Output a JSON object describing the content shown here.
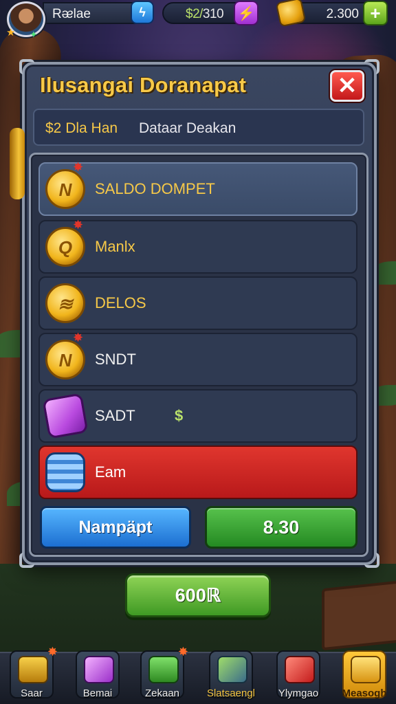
{
  "hud": {
    "player_name": "Rᴂlae",
    "cash_prefix": "$2/",
    "cash_value": "310",
    "coins": "2.300",
    "plus": "+"
  },
  "dialog": {
    "title": "Ilusangai Doranapat",
    "close": "✕",
    "subtitle_accent": "$2 Dla Han",
    "subtitle_rest": "Dataar Deakan",
    "rows": [
      {
        "label": "SALDO DOMPET",
        "icon_text": "N",
        "label_color": "#f7c948"
      },
      {
        "label": "Manlx",
        "icon_text": "Q",
        "label_color": "#f7c948"
      },
      {
        "label": "DELOS",
        "icon_text": "≋",
        "label_color": "#f7c948"
      },
      {
        "label": "SNDT",
        "icon_text": "N",
        "label_color": "#f0f0f0"
      },
      {
        "label": "SADT",
        "amount": "$",
        "label_color": "#f0f0f0"
      },
      {
        "label": "Eam",
        "label_color": "#ffffff"
      }
    ],
    "btn_left": "Nampäpt",
    "btn_right": "8.30"
  },
  "bottom_button": "600ℝ",
  "nav": [
    {
      "label": "Saar",
      "icon": "treasure-chest-icon"
    },
    {
      "label": "Bemai",
      "icon": "gift-box-icon"
    },
    {
      "label": "Zekaan",
      "icon": "cash-stack-icon"
    },
    {
      "label": "Slatsaengl",
      "icon": "sword-icon"
    },
    {
      "label": "Ylymgao",
      "icon": "red-gift-icon"
    },
    {
      "label": "Measogh",
      "icon": "gold-chest-icon"
    }
  ],
  "colors": {
    "accent_gold": "#f7c948",
    "danger_red": "#d42621",
    "primary_blue": "#1f78d9",
    "success_green": "#2f9a2a"
  }
}
